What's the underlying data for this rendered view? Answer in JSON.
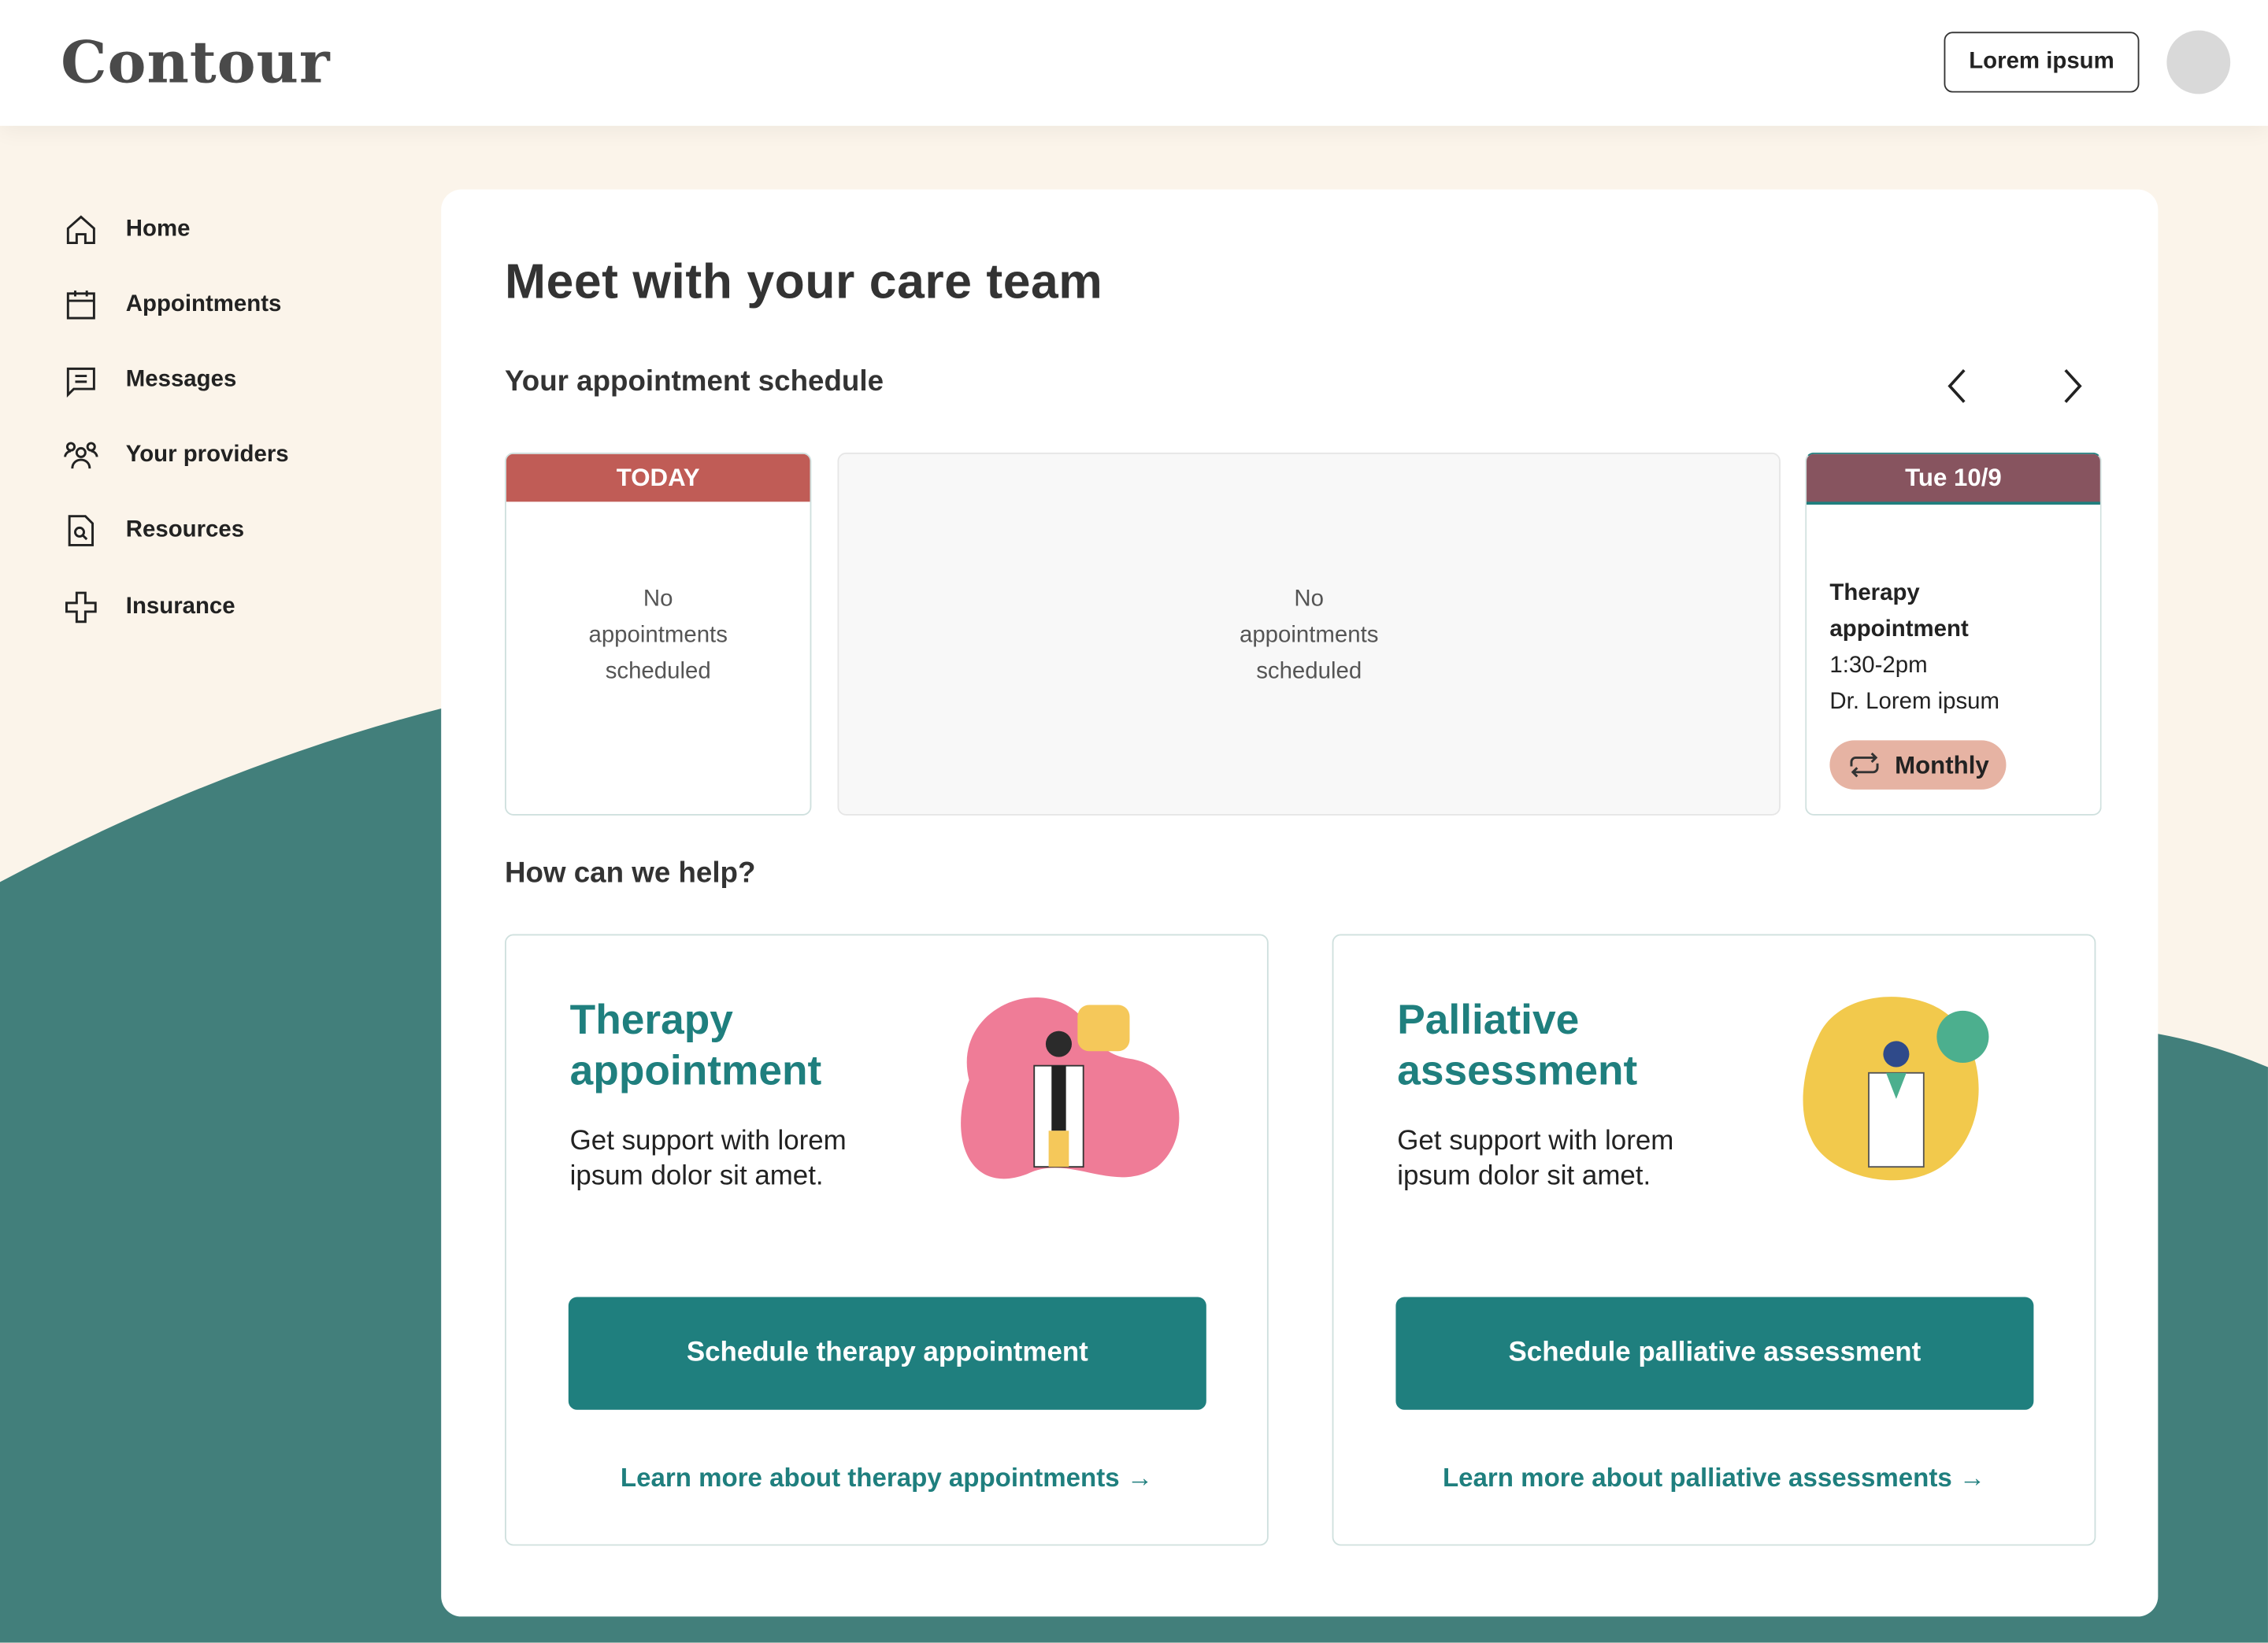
{
  "header": {
    "logo": "Contour",
    "button_label": "Lorem ipsum"
  },
  "sidebar": {
    "items": [
      {
        "label": "Home",
        "icon": "home-icon"
      },
      {
        "label": "Appointments",
        "icon": "calendar-icon"
      },
      {
        "label": "Messages",
        "icon": "message-icon"
      },
      {
        "label": "Your providers",
        "icon": "people-icon"
      },
      {
        "label": "Resources",
        "icon": "document-search-icon"
      },
      {
        "label": "Insurance",
        "icon": "medical-cross-icon"
      }
    ]
  },
  "main": {
    "title": "Meet with your care team",
    "schedule_title": "Your appointment schedule",
    "days": [
      {
        "header": "TODAY",
        "color": "#c05c56",
        "empty": [
          "No",
          "appointments",
          "scheduled"
        ]
      },
      {
        "empty": [
          "No",
          "appointments",
          "scheduled"
        ]
      },
      {
        "header": "Tue 10/9",
        "color": "#87545f",
        "appointment": {
          "title_line1": "Therapy",
          "title_line2": "appointment",
          "time": "1:30-2pm",
          "provider": "Dr. Lorem ipsum",
          "recurrence": "Monthly"
        }
      }
    ],
    "help_title": "How can we help?",
    "cards": [
      {
        "title_line1": "Therapy",
        "title_line2": "appointment",
        "desc": "Get support with lorem ipsum dolor sit amet.",
        "button": "Schedule therapy appointment",
        "link": "Learn more about therapy appointments →"
      },
      {
        "title_line1": "Palliative",
        "title_line2": "assessment",
        "desc": "Get support with lorem ipsum dolor sit amet.",
        "button": "Schedule palliative assessment",
        "link": "Learn more about palliative assessments →"
      }
    ]
  },
  "colors": {
    "accent": "#1f7f7e",
    "background": "#fbf4ea",
    "wave": "#427f7b",
    "badge": "#e6b3a3"
  }
}
